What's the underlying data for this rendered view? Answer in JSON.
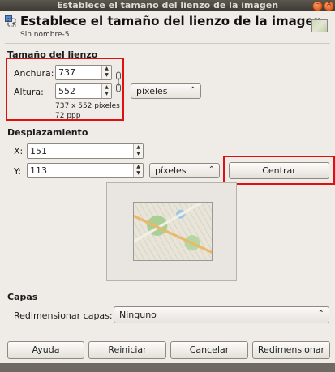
{
  "window": {
    "title": "Establece el tamaño del lienzo de la imagen"
  },
  "header": {
    "title": "Establece el tamaño del lienzo de la imagen",
    "subtitle": "Sin nombre-5"
  },
  "canvas_size": {
    "section_label": "Tamaño del lienzo",
    "width_label": "Anchura:",
    "width_value": "737",
    "height_label": "Altura:",
    "height_value": "552",
    "unit": "píxeles",
    "info_size": "737 x 552 píxeles",
    "info_ppp": "72 ppp"
  },
  "offset": {
    "section_label": "Desplazamiento",
    "x_label": "X:",
    "x_value": "151",
    "y_label": "Y:",
    "y_value": "113",
    "unit": "píxeles",
    "center_button": "Centrar"
  },
  "layers": {
    "section_label": "Capas",
    "resize_label": "Redimensionar capas:",
    "resize_value": "Ninguno"
  },
  "buttons": {
    "help": "Ayuda",
    "reset": "Reiniciar",
    "cancel": "Cancelar",
    "resize": "Redimensionar"
  },
  "colors": {
    "highlight": "#e01010",
    "dialog_bg": "#efebe7"
  }
}
